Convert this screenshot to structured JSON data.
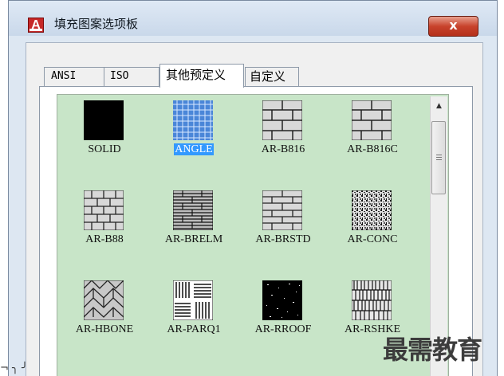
{
  "window": {
    "title": "填充图案选项板",
    "close_label": "x"
  },
  "tabs": [
    {
      "label": "ANSI"
    },
    {
      "label": "ISO"
    },
    {
      "label": "其他预定义"
    },
    {
      "label": "自定义"
    }
  ],
  "patterns": [
    {
      "label": "SOLID"
    },
    {
      "label": "ANGLE",
      "selected": true
    },
    {
      "label": "AR-B816"
    },
    {
      "label": "AR-B816C"
    },
    {
      "label": "AR-B88"
    },
    {
      "label": "AR-BRELM"
    },
    {
      "label": "AR-BRSTD"
    },
    {
      "label": "AR-CONC"
    },
    {
      "label": "AR-HBONE"
    },
    {
      "label": "AR-PARQ1"
    },
    {
      "label": "AR-RROOF"
    },
    {
      "label": "AR-RSHKE"
    }
  ],
  "watermark": "最需教育",
  "left_mark": "¬ ╮ ╯"
}
